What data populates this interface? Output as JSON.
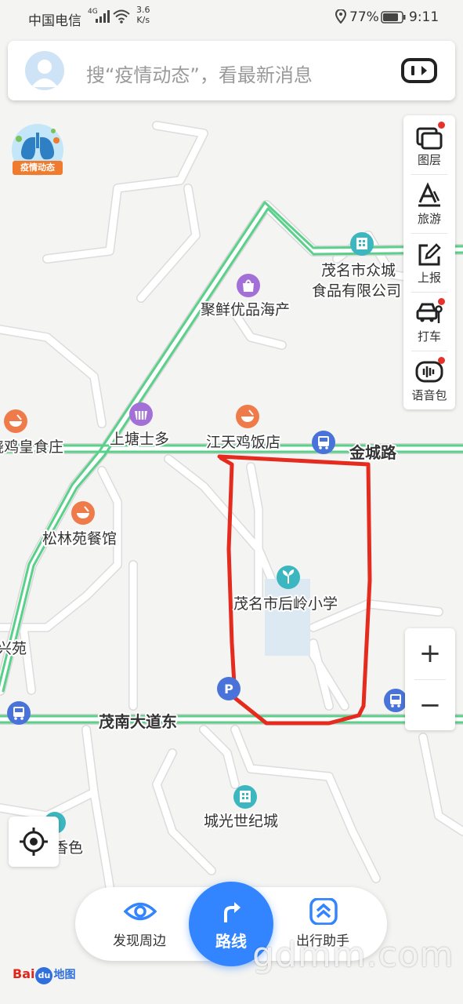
{
  "status_bar": {
    "carrier": "中国电信",
    "network": "4G",
    "speed_value": "3.6",
    "speed_unit": "K/s",
    "battery": "77%",
    "time": "9:11"
  },
  "search": {
    "placeholder": "搜“疫情动态”，看最新消息"
  },
  "epidemic_badge": {
    "label": "疫情动态"
  },
  "toolbar": {
    "items": [
      {
        "label": "图层",
        "icon": "layers-icon",
        "has_dot": true
      },
      {
        "label": "旅游",
        "icon": "travel-icon",
        "has_dot": false
      },
      {
        "label": "上报",
        "icon": "report-icon",
        "has_dot": false
      },
      {
        "label": "打车",
        "icon": "taxi-icon",
        "has_dot": true
      },
      {
        "label": "语音包",
        "icon": "voice-pack-icon",
        "has_dot": true
      }
    ]
  },
  "zoom": {
    "in": "+",
    "out": "−"
  },
  "map": {
    "roads": [
      "金城路",
      "茂南大道东"
    ],
    "pois": [
      {
        "name": "茂名市众城",
        "type": "building"
      },
      {
        "name": "食品有限公司",
        "type": "building-line2"
      },
      {
        "name": "聚鲜优品海产",
        "type": "shop"
      },
      {
        "name": "上塘士多",
        "type": "shop"
      },
      {
        "name": "江天鸡饭店",
        "type": "food"
      },
      {
        "name": "饶鸡皇食庄",
        "type": "food"
      },
      {
        "name": "松林苑餐馆",
        "type": "food"
      },
      {
        "name": "茂名市后岭小学",
        "type": "school"
      },
      {
        "name": "兴苑",
        "type": "area"
      },
      {
        "name": "城光世纪城",
        "type": "building"
      },
      {
        "name": "香色",
        "type": "area"
      }
    ],
    "colors": {
      "background": "#f4f4f2",
      "road": "#ffffff",
      "traffic_green": "#5bd08a",
      "poi_orange": "#f07b4a",
      "poi_purple": "#a370d8",
      "poi_teal": "#3cb6bf",
      "bus_blue": "#4a73d9",
      "annotation_red": "#e52a1e"
    }
  },
  "bottom_bar": {
    "discover": "发现周边",
    "route": "路线",
    "assistant": "出行助手"
  },
  "watermark": "gdmm.com",
  "logo": {
    "bai": "Bai",
    "du": "du",
    "ditu": "地图"
  }
}
